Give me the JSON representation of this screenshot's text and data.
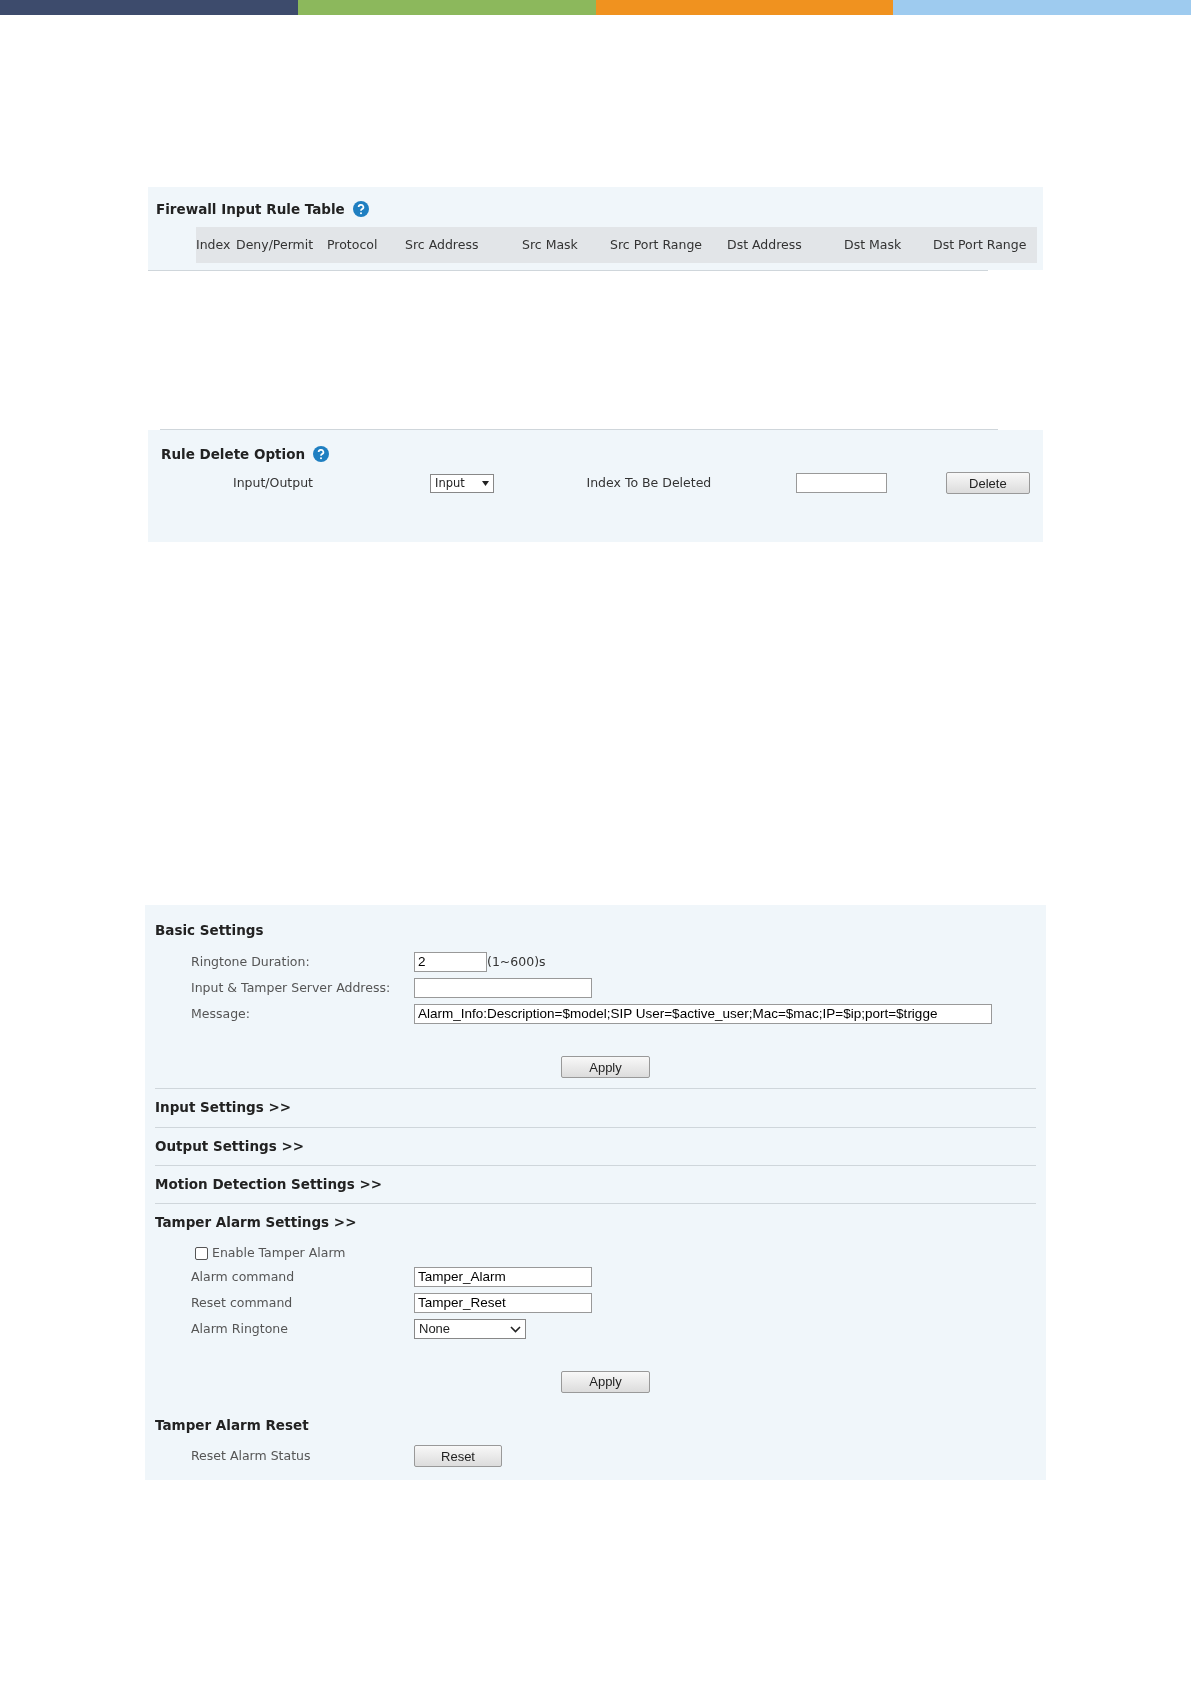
{
  "firewall_table": {
    "title": "Firewall Input Rule Table",
    "columns": [
      "Index",
      "Deny/Permit",
      "Protocol",
      "Src Address",
      "Src Mask",
      "Src Port Range",
      "Dst Address",
      "Dst Mask",
      "Dst Port Range"
    ]
  },
  "rule_delete": {
    "title": "Rule Delete Option",
    "io_label": "Input/Output",
    "io_select": "Input",
    "index_label": "Index To Be Deleted",
    "button": "Delete"
  },
  "basic_settings": {
    "title": "Basic Settings",
    "fields": [
      {
        "label": "Ringtone Duration:",
        "value": "2",
        "suffix": "(1~600)s",
        "kind": "short"
      },
      {
        "label": "Input & Tamper Server Address:",
        "kind": "medium"
      },
      {
        "label": "Message:",
        "value": "Alarm_Info:Description=$model;SIP User=$active_user;Mac=$mac;IP=$ip;port=$trigge",
        "kind": "long"
      }
    ],
    "button": "Apply"
  },
  "sections": [
    "Input Settings >>",
    "Output Settings >>",
    "Motion Detection Settings >>"
  ],
  "tamper": {
    "title": "Tamper Alarm Settings >>",
    "enable": {
      "label": "Enable Tamper Alarm",
      "checked": false
    },
    "fields": [
      {
        "label": "Alarm command",
        "value": "Tamper_Alarm",
        "kind": "text"
      },
      {
        "label": "Reset command",
        "value": "Tamper_Reset",
        "kind": "text"
      },
      {
        "label": "Alarm Ringtone",
        "value": "None",
        "kind": "select"
      }
    ],
    "button": "Apply"
  },
  "reset": {
    "title": "Tamper Alarm Reset",
    "label": "Reset Alarm Status",
    "button": "Reset"
  }
}
